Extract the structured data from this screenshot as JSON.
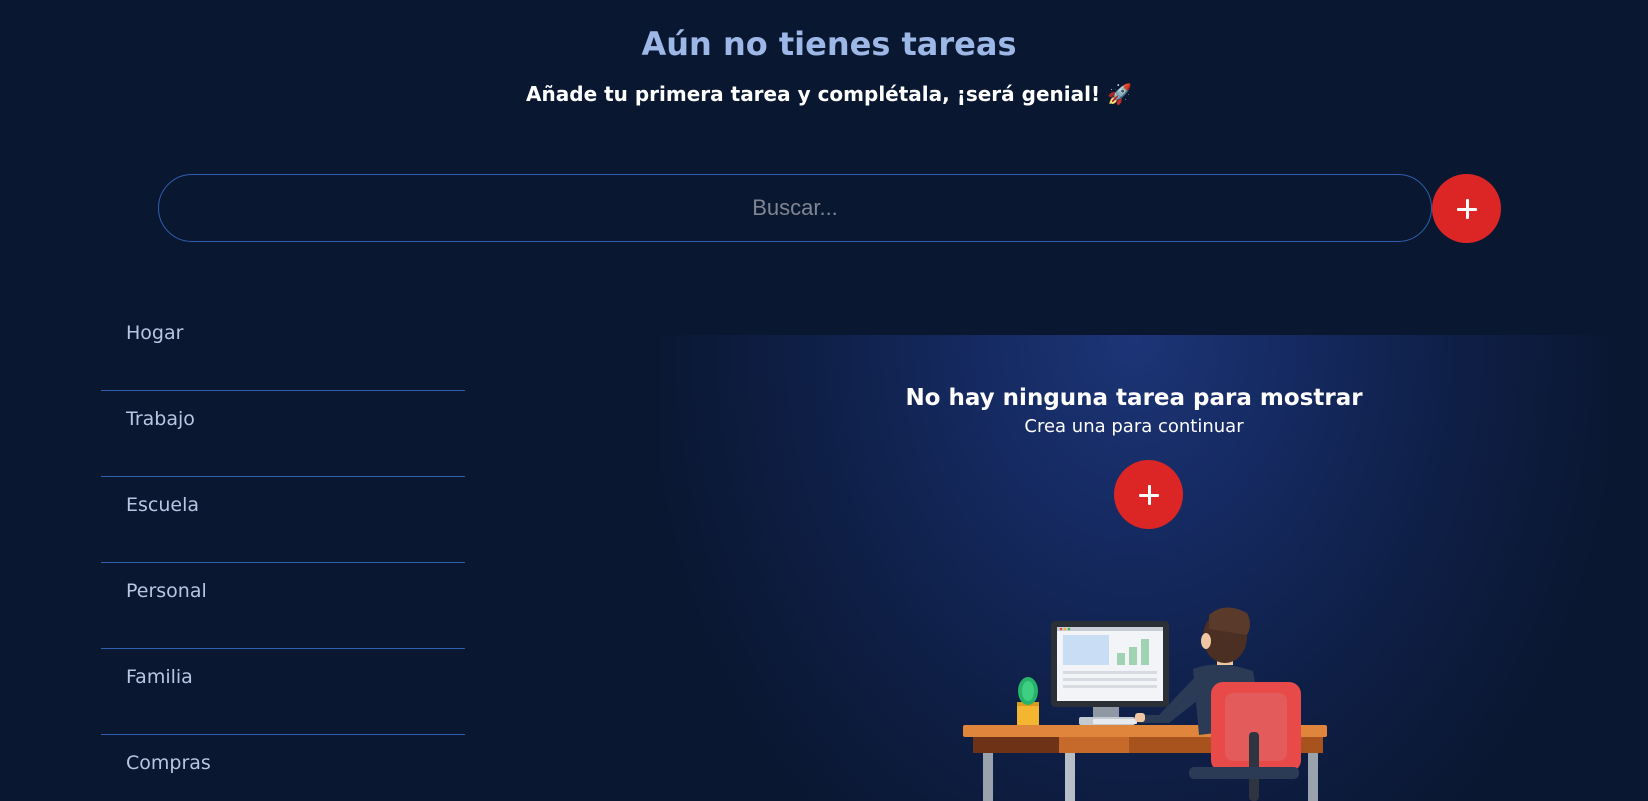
{
  "header": {
    "title": "Aún no tienes tareas",
    "subtitle": "Añade tu primera tarea y complétala, ¡será genial! 🚀"
  },
  "search": {
    "placeholder": "Buscar...",
    "add_button_icon": "plus-icon"
  },
  "sidebar": {
    "categories": [
      {
        "label": "Hogar"
      },
      {
        "label": "Trabajo"
      },
      {
        "label": "Escuela"
      },
      {
        "label": "Personal"
      },
      {
        "label": "Familia"
      },
      {
        "label": "Compras"
      }
    ]
  },
  "empty_state": {
    "title": "No hay ninguna tarea para mostrar",
    "subtitle": "Crea una para continuar",
    "add_button_icon": "plus-icon"
  },
  "colors": {
    "background": "#0a1731",
    "accent_red": "#dc2626",
    "title_blue": "#9db7e6",
    "divider_blue": "#2f5fb0"
  }
}
